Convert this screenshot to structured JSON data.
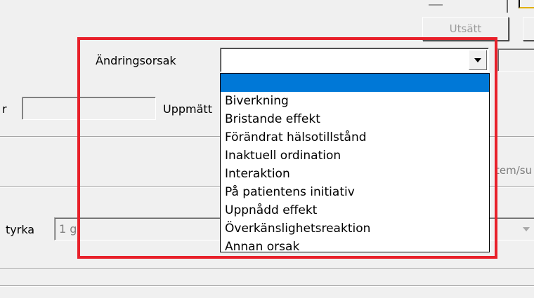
{
  "buttons": {
    "utsatt_label": "Utsätt"
  },
  "fields": {
    "andringsorsak_label": "Ändringsorsak",
    "andringsorsak_value": "",
    "left_r_label": "r",
    "uppmatt_label": "Uppmätt",
    "tem_label": "tem/su",
    "tyrka_label": "tyrka",
    "tyrka_value": "1 g"
  },
  "dropdown": {
    "items": [
      "",
      "Biverkning",
      "Bristande effekt",
      "Förändrat hälsotillstånd",
      "Inaktuell ordination",
      "Interaktion",
      "På patientens initiativ",
      "Uppnådd effekt",
      "Överkänslighetsreaktion",
      "Annan orsak"
    ],
    "selected_index": 0
  },
  "colors": {
    "highlight_frame": "#e8202a",
    "selection": "#0078d7"
  }
}
